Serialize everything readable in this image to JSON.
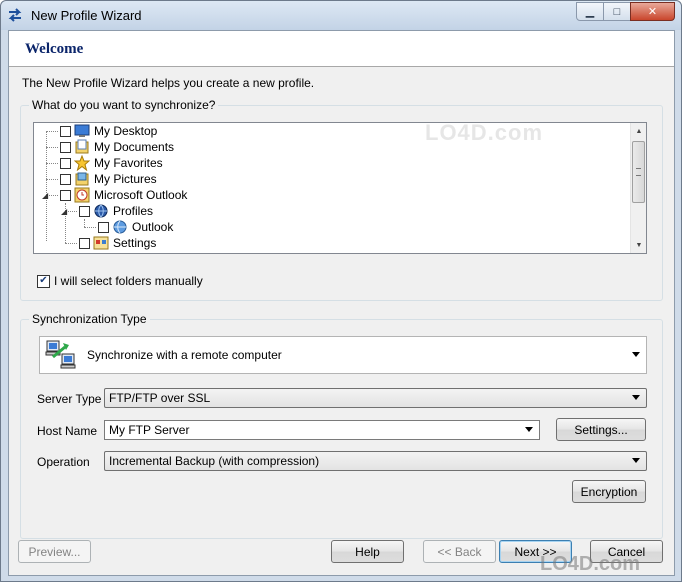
{
  "window": {
    "title": "New Profile Wizard"
  },
  "header": {
    "title": "Welcome"
  },
  "intro": "The New Profile Wizard helps you create a new profile.",
  "sync_group": {
    "label": "What do you want to synchronize?",
    "tree": [
      {
        "label": "My Desktop",
        "icon": "desktop-icon",
        "checked": false
      },
      {
        "label": "My Documents",
        "icon": "documents-icon",
        "checked": false
      },
      {
        "label": "My Favorites",
        "icon": "favorites-star-icon",
        "checked": false
      },
      {
        "label": "My Pictures",
        "icon": "pictures-icon",
        "checked": false
      },
      {
        "label": "Microsoft Outlook",
        "icon": "outlook-clock-icon",
        "checked": false,
        "expanded": true
      },
      {
        "label": "Profiles",
        "icon": "profiles-globe-icon",
        "checked": false,
        "expanded": true
      },
      {
        "label": "Outlook",
        "icon": "outlook-globe-icon",
        "checked": false
      },
      {
        "label": "Settings",
        "icon": "settings-icon",
        "checked": false
      }
    ],
    "manual_checkbox": {
      "label": "I will select folders manually",
      "checked": true
    }
  },
  "sync_type_group": {
    "label": "Synchronization Type",
    "sync_type": "Synchronize with a remote computer",
    "server_type": {
      "label": "Server Type",
      "value": "FTP/FTP over SSL"
    },
    "host_name": {
      "label": "Host Name",
      "value": "My FTP Server"
    },
    "operation": {
      "label": "Operation",
      "value": "Incremental Backup (with compression)"
    },
    "settings_button": "Settings...",
    "encryption_button": "Encryption"
  },
  "footer": {
    "preview": "Preview...",
    "help": "Help",
    "back": "<< Back",
    "next": "Next >>",
    "cancel": "Cancel"
  },
  "watermark": {
    "text": "LO4D.com"
  },
  "colors": {
    "header_title": "#0a246a",
    "window_frame": "#cfdbe9",
    "dialog_bg": "#f0f0f0"
  }
}
